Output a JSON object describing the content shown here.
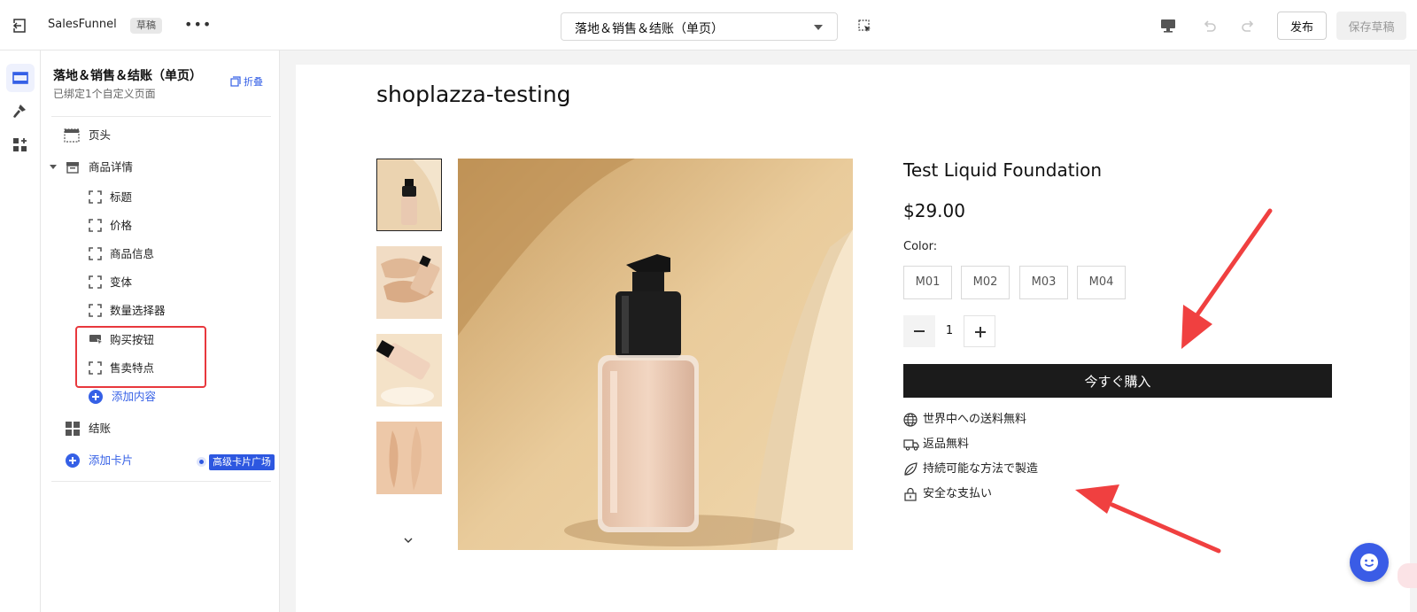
{
  "topbar": {
    "app_name": "SalesFunnel",
    "draft_badge": "草稿",
    "more_label": "•••",
    "page_selector": "落地＆销售＆结账（单页）",
    "publish_label": "发布",
    "save_draft_label": "保存草稿"
  },
  "panel": {
    "title": "落地＆销售＆结账（单页）",
    "subtitle": "已绑定1个自定义页面",
    "collapse_label": "折叠",
    "header_item": "页头",
    "product_section": "商品详情",
    "children": [
      "标题",
      "价格",
      "商品信息",
      "变体",
      "数量选择器",
      "购买按钮",
      "售卖特点"
    ],
    "add_content": "添加内容",
    "checkout_item": "结账",
    "add_card": "添加卡片",
    "premium_badge": "高级卡片广场"
  },
  "preview": {
    "store_name": "shoplazza-testing",
    "product_name": "Test Liquid Foundation",
    "price": "$29.00",
    "color_label": "Color:",
    "variants": [
      "M01",
      "M02",
      "M03",
      "M04"
    ],
    "quantity": "1",
    "buy_button": "今すぐ購入",
    "features": [
      "世界中への送料無料",
      "返品無料",
      "持続可能な方法で製造",
      "安全な支払い"
    ]
  },
  "colors": {
    "accent": "#3560e6",
    "highlight": "#e8383d",
    "arrow": "#f04040",
    "buy_button": "#1b1b1b"
  }
}
